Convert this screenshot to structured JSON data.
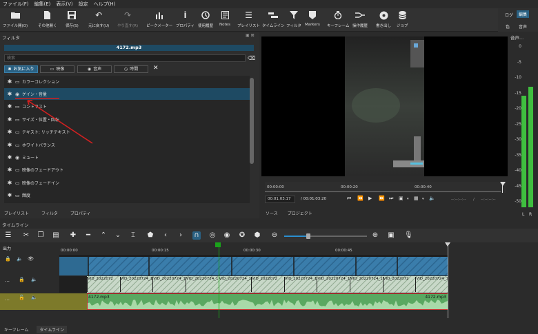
{
  "menu": [
    "ファイル(F)",
    "編集(E)",
    "表示(V)",
    "設定",
    "ヘルプ(H)"
  ],
  "toolbar": [
    {
      "label": "ファイル開(O)",
      "icon": "folder-icon",
      "disabled": false
    },
    {
      "label": "その他開く",
      "icon": "open-other-icon",
      "disabled": false
    },
    {
      "label": "保存(S)",
      "icon": "save-icon",
      "disabled": false
    },
    {
      "label": "元に戻す(U)",
      "icon": "undo-icon",
      "disabled": false
    },
    {
      "label": "やり直す(R)",
      "icon": "redo-icon",
      "disabled": true
    },
    {
      "label": "ピークメーター",
      "icon": "peak-meter-icon",
      "disabled": false
    },
    {
      "label": "プロパティ",
      "icon": "info-icon",
      "disabled": false
    },
    {
      "label": "使用履歴",
      "icon": "history-icon",
      "disabled": false
    },
    {
      "label": "Notes",
      "icon": "notes-icon",
      "disabled": false
    },
    {
      "label": "プレイリスト",
      "icon": "playlist-icon",
      "disabled": false
    },
    {
      "label": "タイムライン",
      "icon": "timeline-icon",
      "disabled": false
    },
    {
      "label": "フィルタ",
      "icon": "filter-icon",
      "disabled": false
    },
    {
      "label": "Markers",
      "icon": "markers-icon",
      "disabled": false
    },
    {
      "label": "キーフレーム",
      "icon": "keyframe-icon",
      "disabled": false
    },
    {
      "label": "操作履歴",
      "icon": "job-history-icon",
      "disabled": false
    },
    {
      "label": "書き出し",
      "icon": "export-icon",
      "disabled": false
    },
    {
      "label": "ジョブ",
      "icon": "jobs-icon",
      "disabled": false
    }
  ],
  "layout_tabs": {
    "log": "ログ",
    "edit": "編集",
    "color": "色",
    "audio": "音声"
  },
  "filter_panel": {
    "title": "フィルタ",
    "filename": "4172.mp3",
    "search_placeholder": "検索",
    "tabs": [
      {
        "label": "お気に入り",
        "selected": true
      },
      {
        "label": "映像",
        "selected": false
      },
      {
        "label": "音声",
        "selected": false
      },
      {
        "label": "時間",
        "selected": false
      }
    ],
    "items": [
      {
        "label": "カラーコレクション",
        "type": "video",
        "selected": false
      },
      {
        "label": "ゲイン・音量",
        "type": "audio",
        "selected": true
      },
      {
        "label": "コントラスト",
        "type": "video",
        "selected": false
      },
      {
        "label": "サイズ・位置・回転",
        "type": "video",
        "selected": false
      },
      {
        "label": "テキスト: リッチテキスト",
        "type": "video",
        "selected": false
      },
      {
        "label": "ホワイトバランス",
        "type": "video",
        "selected": false
      },
      {
        "label": "ミュート",
        "type": "audio",
        "selected": false
      },
      {
        "label": "映像のフェードアウト",
        "type": "video",
        "selected": false
      },
      {
        "label": "映像のフェードイン",
        "type": "video",
        "selected": false
      },
      {
        "label": "輝度",
        "type": "video",
        "selected": false
      }
    ],
    "bottom_tabs": [
      "プレイリスト",
      "フィルタ",
      "プロパティ"
    ]
  },
  "viewer": {
    "ruler_ticks": [
      "00:00:00",
      "00:00:20",
      "00:00:40"
    ],
    "current_time": "00:01:03:17",
    "total_time": "/ 00:01:03:20",
    "in_point": "--:--:--:--",
    "out_point": "--:--:--:--",
    "tabs": [
      "ソース",
      "プロジェクト"
    ]
  },
  "meter": {
    "title": "音声...",
    "labels": [
      "0",
      "-5",
      "-10",
      "-15",
      "-20",
      "-25",
      "-30",
      "-35",
      "-40",
      "-45",
      "-50"
    ],
    "channels": [
      "L",
      "R"
    ],
    "left_level_db": -16,
    "right_level_db": -13
  },
  "timeline": {
    "title": "タイムライン",
    "output_label": "出力",
    "ruler_ticks": [
      "00:00:00",
      "00:00:15",
      "00:00:30",
      "00:00:45"
    ],
    "v1_clips": [
      "VID_2022072",
      "VID_20220724_194",
      "VID_20220724_19431",
      "VID_20220724_194",
      "VID_20220724_1",
      "VID_2022072",
      "VID_20220724_19",
      "VID_20220724_19431",
      "VID_20220724_194",
      "VID_2022072",
      "VID_20220724_19431"
    ],
    "audio_clip_start": "4172.mp3",
    "audio_clip_end": "4172.mp3"
  },
  "bottom_tabs": [
    "キーフレーム",
    "タイムライン"
  ],
  "colors": {
    "accent": "#2a6183",
    "selection": "#1e4a63",
    "annotation": "#d42020",
    "playhead": "#1aa31a",
    "audio_track_head": "#7d7a2a"
  }
}
